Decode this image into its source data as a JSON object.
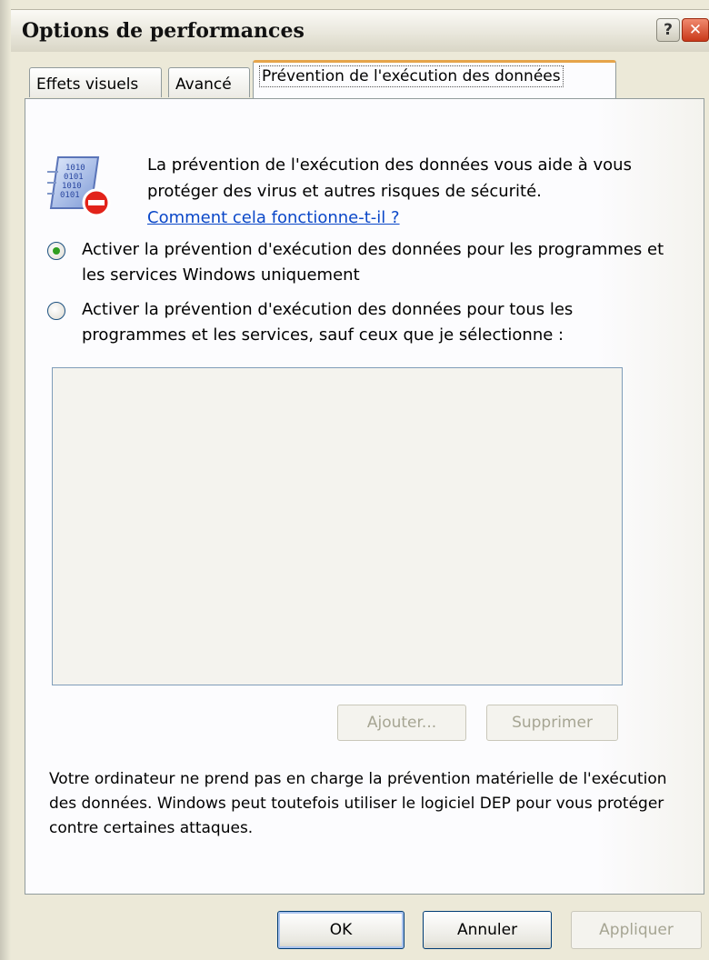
{
  "window": {
    "title": "Options de performances"
  },
  "title_buttons": {
    "help": "?",
    "close": "✕"
  },
  "tabs": [
    {
      "label": "Effets visuels"
    },
    {
      "label": "Avancé"
    },
    {
      "label": "Prévention de l'exécution des données",
      "active": true
    }
  ],
  "dep": {
    "icon": "dep-shield-binary-icon",
    "description": "La prévention de l'exécution des données vous aide à vous protéger des virus et autres risques de sécurité.",
    "help_link": "Comment cela fonctionne-t-il ?",
    "options": [
      {
        "label": "Activer la prévention d'exécution des données pour les programmes et les services Windows uniquement",
        "checked": true
      },
      {
        "label": "Activer la prévention d'exécution des données pour tous les programmes et les services, sauf ceux que je sélectionne :",
        "checked": false
      }
    ],
    "add_label": "Ajouter...",
    "remove_label": "Supprimer",
    "note": "Votre ordinateur ne prend pas en charge la prévention matérielle de l'exécution des données. Windows peut toutefois utiliser le logiciel DEP pour vous protéger contre certaines attaques."
  },
  "footer": {
    "ok_label": "OK",
    "cancel_label": "Annuler",
    "apply_label": "Appliquer"
  },
  "colors": {
    "link": "#0a47c8",
    "active_tab_accent": "#e6a44a",
    "radio_dot": "#2f9e20"
  }
}
